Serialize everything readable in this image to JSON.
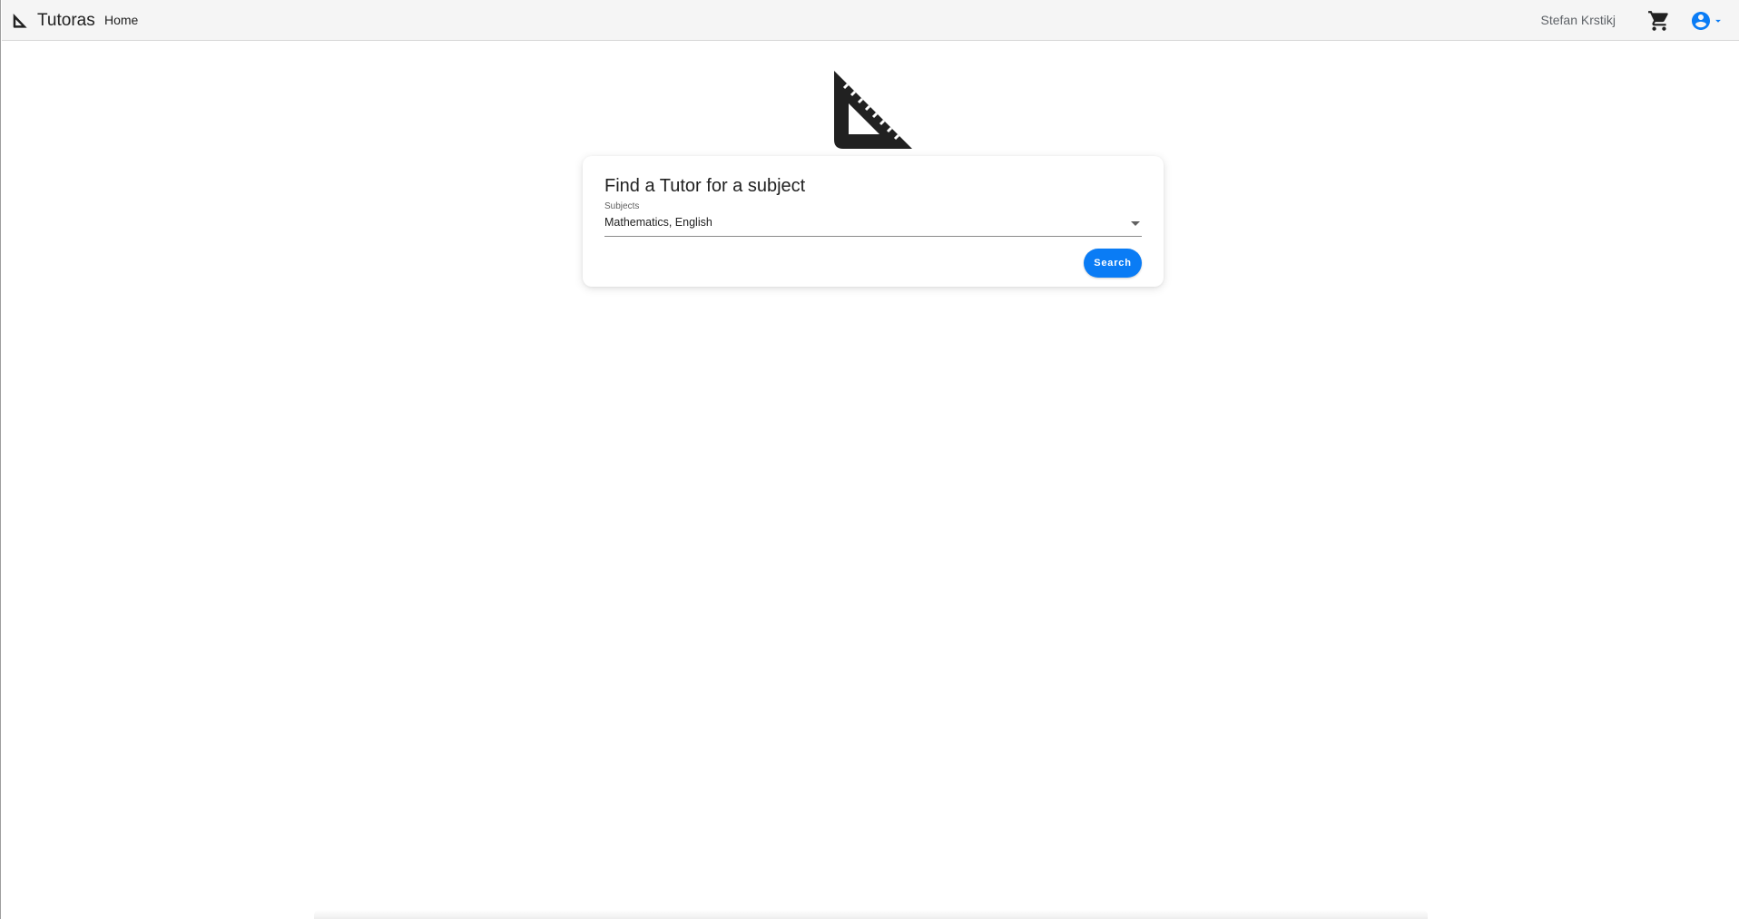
{
  "navbar": {
    "brand_name": "Tutoras",
    "brand_icon": "set-square-icon",
    "links": [
      {
        "label": "Home"
      }
    ],
    "user_name": "Stefan Krstikj",
    "cart_icon": "cart-icon",
    "account_icon": "account-circle-icon"
  },
  "hero": {
    "logo_icon": "set-square-icon"
  },
  "search_card": {
    "title": "Find a Tutor for a subject",
    "subjects_label": "Subjects",
    "subjects_value": "Mathematics, English",
    "search_button_label": "Search"
  },
  "colors": {
    "accent": "#0a7cf5",
    "navbar_bg": "#f5f5f5",
    "logo": "#212121"
  }
}
